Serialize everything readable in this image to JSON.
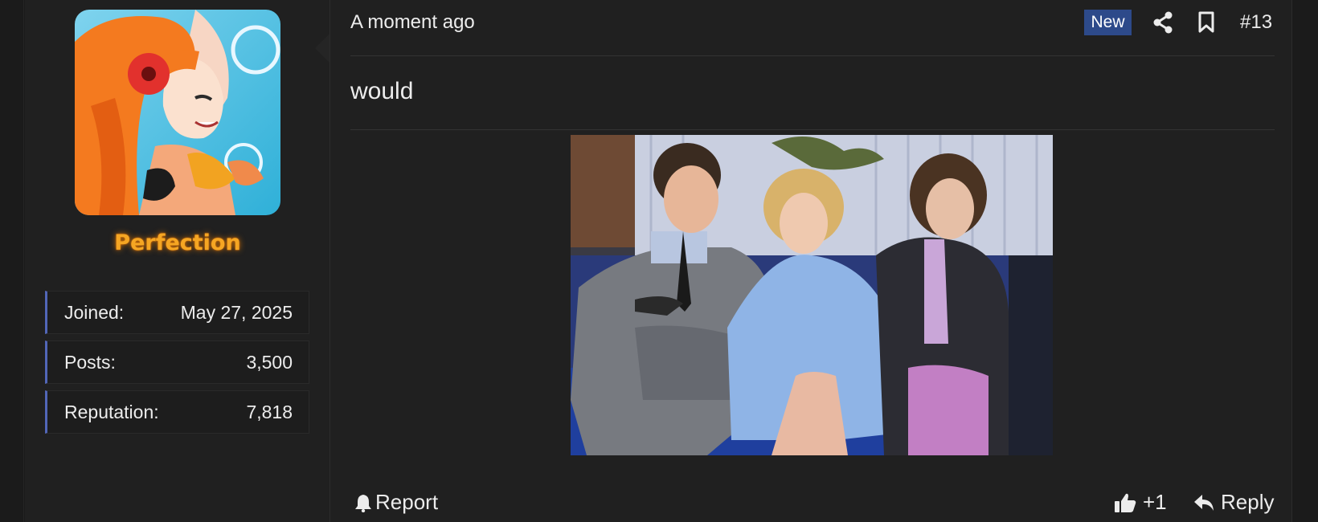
{
  "user": {
    "name": "Perfection",
    "stats": [
      {
        "label": "Joined:",
        "value": "May 27, 2025"
      },
      {
        "label": "Posts:",
        "value": "3,500"
      },
      {
        "label": "Reputation:",
        "value": "7,818"
      }
    ]
  },
  "post": {
    "timestamp": "A moment ago",
    "badge": "New",
    "number": "#13",
    "text": "would",
    "icons": [
      "share-icon",
      "bookmark-icon",
      "bell-icon",
      "thumbs-up-icon",
      "reply-icon"
    ]
  },
  "actions": {
    "report": "Report",
    "like": "+1",
    "reply": "Reply"
  },
  "colors": {
    "username": "#f5a623",
    "badge_bg": "#2d4a8a",
    "stat_accent": "#5266b8",
    "panel_bg": "#202020"
  }
}
